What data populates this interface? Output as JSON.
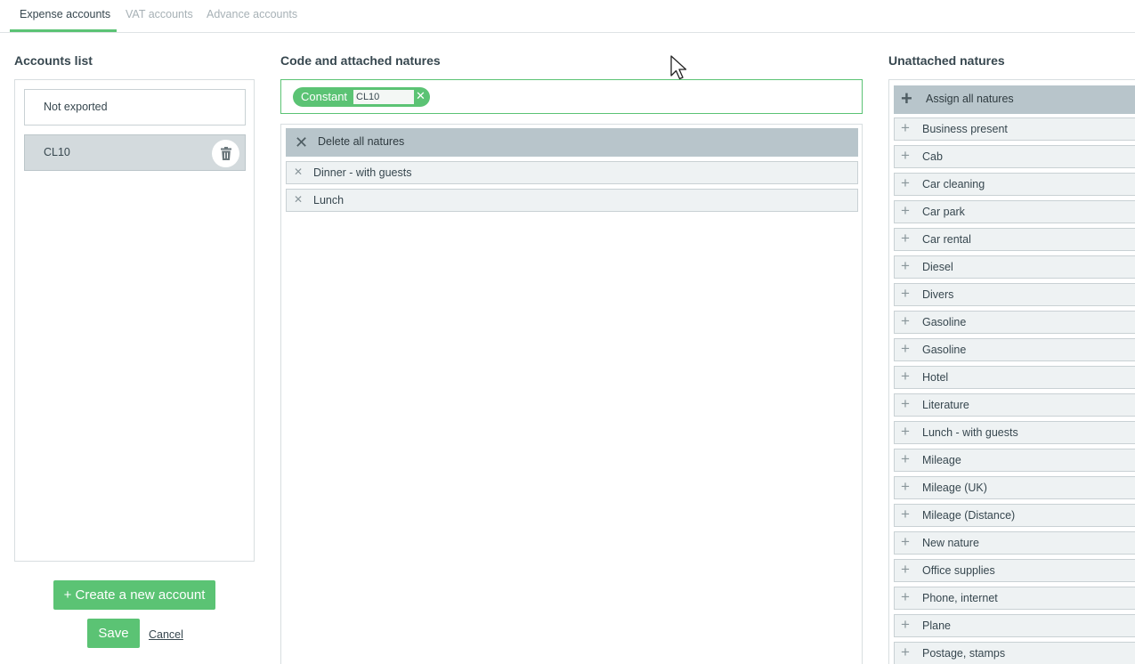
{
  "tabs": [
    "Expense accounts",
    "VAT accounts",
    "Advance accounts"
  ],
  "active_tab": "Expense accounts",
  "accounts": {
    "title": "Accounts list",
    "items": [
      "Not exported",
      "CL10"
    ],
    "selected": "CL10",
    "create_label": "+ Create a new account",
    "save_label": "Save",
    "cancel_label": "Cancel"
  },
  "code": {
    "title": "Code and attached natures",
    "constant_label": "Constant",
    "code_value": "CL10",
    "delete_all_label": "Delete all natures",
    "attached": [
      "Dinner - with guests",
      "Lunch"
    ]
  },
  "unattached": {
    "title": "Unattached natures",
    "assign_all_label": "Assign all natures",
    "items": [
      "Business present",
      "Cab",
      "Car cleaning",
      "Car park",
      "Car rental",
      "Diesel",
      "Divers",
      "Gasoline",
      "Gasoline",
      "Hotel",
      "Literature",
      "Lunch - with guests",
      "Mileage",
      "Mileage (UK)",
      "Mileage (Distance)",
      "New nature",
      "Office supplies",
      "Phone, internet",
      "Plane",
      "Postage, stamps"
    ]
  },
  "colors": {
    "accent": "#5bc374",
    "bar_gray": "#b8c5cb",
    "row_bg": "#eef2f3",
    "selected_bg": "#d3dadd"
  }
}
